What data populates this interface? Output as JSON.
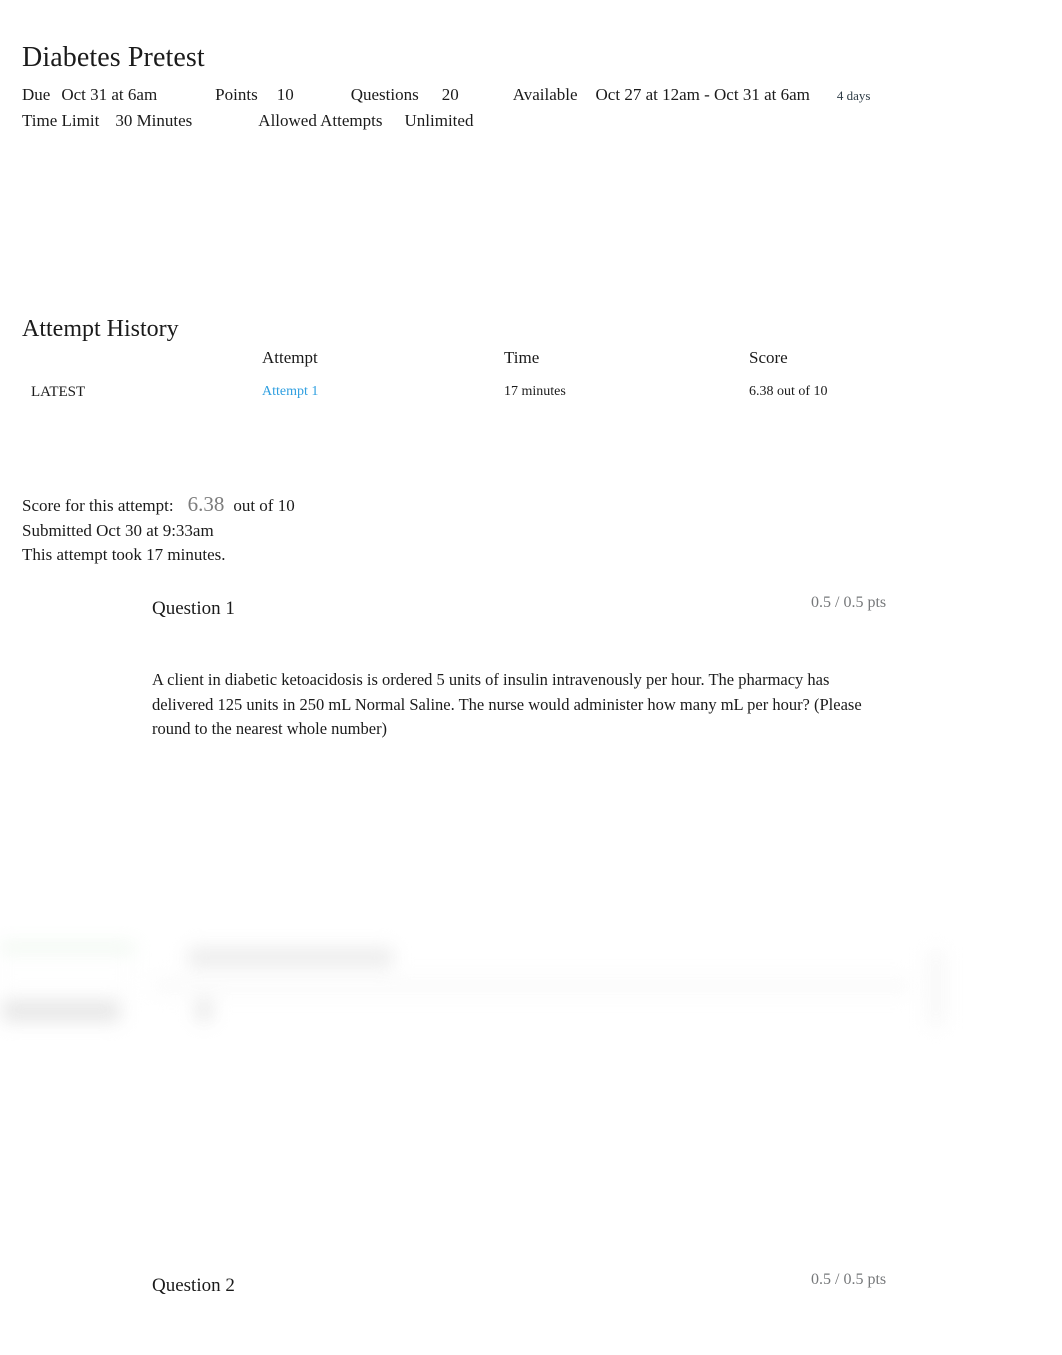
{
  "quiz": {
    "title": "Diabetes Pretest",
    "meta": {
      "due_label": "Due",
      "due_value": "Oct 31 at 6am",
      "points_label": "Points",
      "points_value": "10",
      "questions_label": "Questions",
      "questions_value": "20",
      "available_label": "Available",
      "available_value": "Oct 27 at 12am - Oct 31 at 6am",
      "available_duration": "4 days",
      "time_limit_label": "Time Limit",
      "time_limit_value": "30 Minutes",
      "allowed_attempts_label": "Allowed Attempts",
      "allowed_attempts_value": "Unlimited"
    }
  },
  "attempt_history": {
    "heading": "Attempt History",
    "columns": {
      "flag": "",
      "attempt": "Attempt",
      "time": "Time",
      "score": "Score"
    },
    "rows": [
      {
        "flag": "LATEST",
        "attempt": "Attempt 1",
        "time": "17 minutes",
        "score": "6.38 out of 10"
      }
    ]
  },
  "score_summary": {
    "label": "Score for this attempt:",
    "score": "6.38",
    "out_of": "out of 10",
    "submitted": "Submitted Oct 30 at 9:33am",
    "duration": "This attempt took 17 minutes."
  },
  "questions": [
    {
      "name": "Question 1",
      "points": "0.5 / 0.5 pts",
      "text": "A client in diabetic ketoacidosis is ordered 5 units of insulin intravenously per hour. The pharmacy has delivered 125 units in 250 mL Normal Saline. The nurse would administer how many mL per hour? (Please round to the nearest whole number)"
    },
    {
      "name": "Question 2",
      "points": "0.5 / 0.5 pts",
      "text": ""
    }
  ],
  "colors": {
    "link": "#2f9fe0",
    "points_text": "#76787a",
    "score_number": "#7d7d7d",
    "body_text": "#1b1b1b",
    "correct_strip": "#c8e6c9"
  }
}
